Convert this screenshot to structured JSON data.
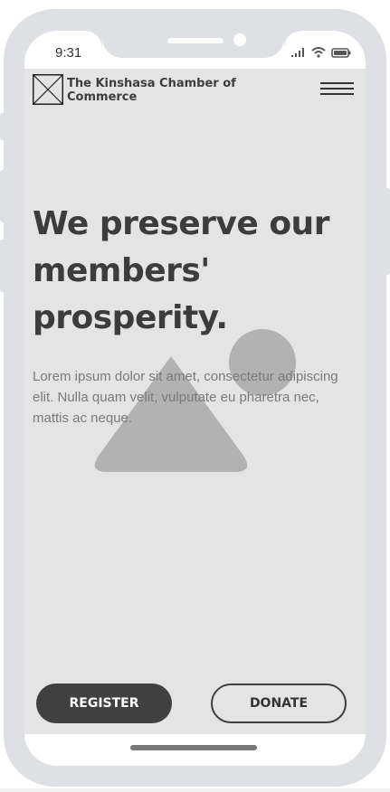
{
  "status_bar": {
    "time": "9:31",
    "icons": [
      "signal-icon",
      "wifi-icon",
      "battery-icon"
    ]
  },
  "header": {
    "org_name": "The Kinshasa Chamber of Commerce",
    "logo": "logo-placeholder-icon",
    "menu_icon": "hamburger-menu-icon"
  },
  "hero": {
    "title": "We preserve our members' prosperity.",
    "text": "Lorem ipsum dolor sit amet, consectetur adipiscing elit. Nulla quam velit, vulputate eu pharetra nec, mattis ac neque.",
    "image_icon": "image-placeholder-icon"
  },
  "actions": {
    "register_label": "REGISTER",
    "donate_label": "DONATE"
  },
  "colors": {
    "frame": "#dde0e5",
    "app_background": "#e4e4e4",
    "primary_button": "#404040",
    "text_dark": "#3c3c3c",
    "text_muted": "#7a7a7a"
  }
}
